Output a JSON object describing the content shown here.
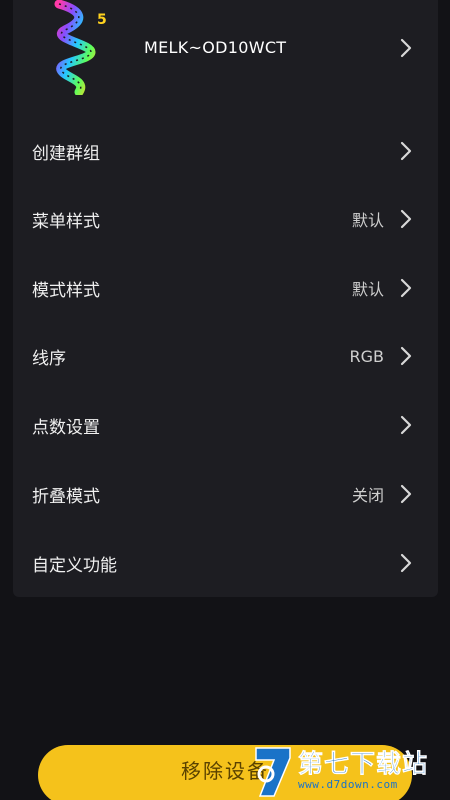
{
  "device": {
    "name": "MELK~OD10WCT",
    "icon": "led-strip-logo-icon",
    "badge": "5"
  },
  "menu": [
    {
      "label": "创建群组",
      "value": ""
    },
    {
      "label": "菜单样式",
      "value": "默认"
    },
    {
      "label": "模式样式",
      "value": "默认"
    },
    {
      "label": "线序",
      "value": "RGB"
    },
    {
      "label": "点数设置",
      "value": ""
    },
    {
      "label": "折叠模式",
      "value": "关闭"
    },
    {
      "label": "自定义功能",
      "value": ""
    }
  ],
  "footer": {
    "remove_label": "移除设备"
  },
  "watermark": {
    "title": "第七下载站",
    "url": "www.d7down.com"
  },
  "colors": {
    "background": "#121216",
    "panel": "#1d1d22",
    "accent": "#f5c21b",
    "watermark": "#1a73c8"
  }
}
